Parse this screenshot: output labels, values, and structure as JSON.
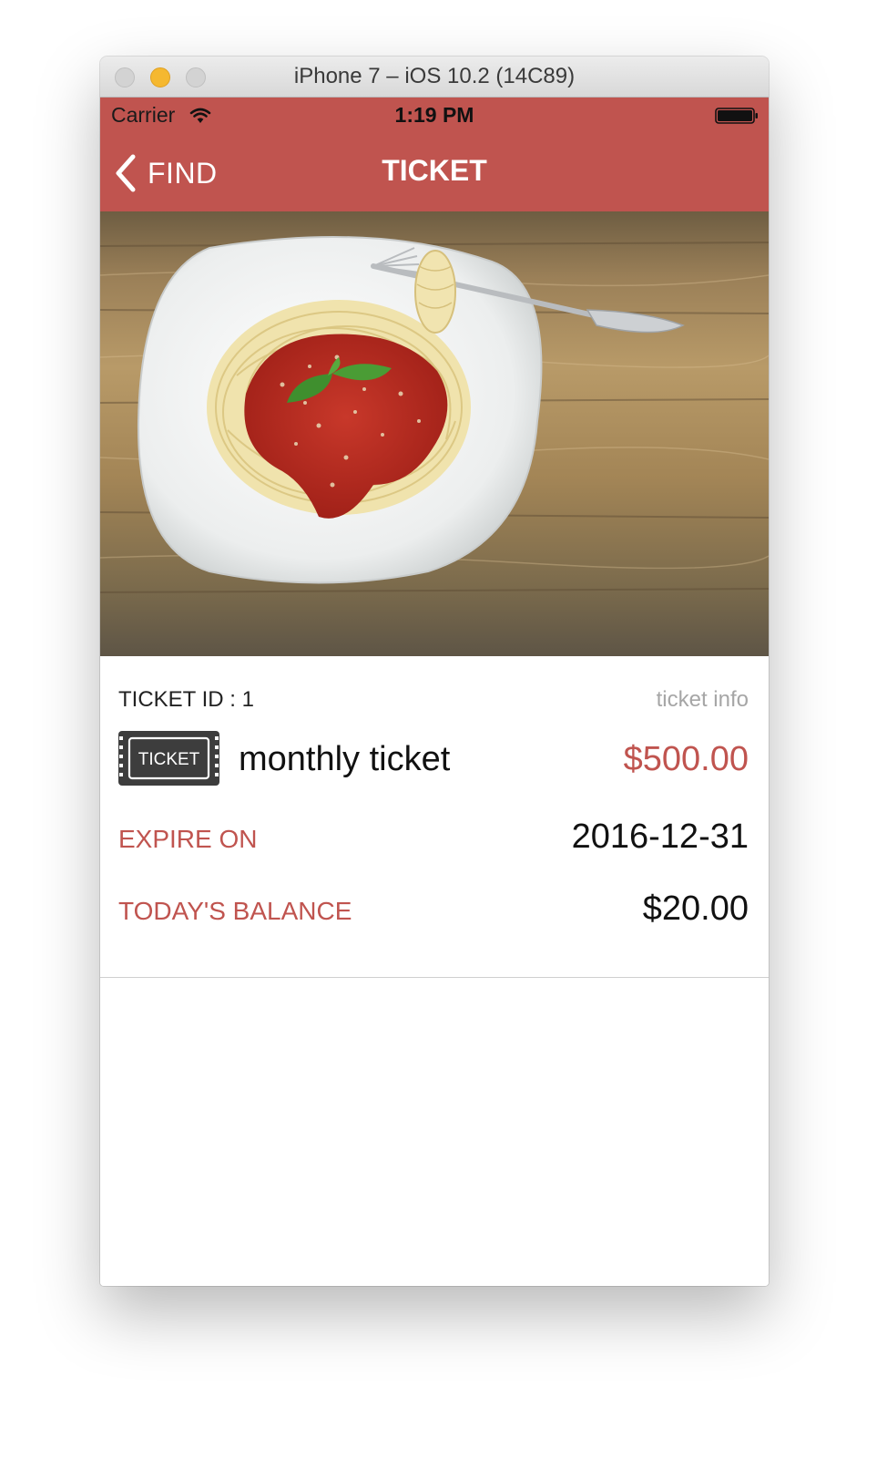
{
  "window": {
    "title": "iPhone 7 – iOS 10.2 (14C89)"
  },
  "status_bar": {
    "carrier": "Carrier",
    "time": "1:19 PM",
    "wifi_icon": "wifi-icon",
    "battery_icon": "battery-icon"
  },
  "nav": {
    "back_label": "FIND",
    "back_icon": "chevron-left-icon",
    "title": "TICKET"
  },
  "photo": {
    "subject": "spaghetti-plate-image"
  },
  "ticket": {
    "id_label": "TICKET ID : 1",
    "info_link": "ticket info",
    "badge_text": "TICKET",
    "name": "monthly ticket",
    "price": "$500.00",
    "expire_label": "EXPIRE ON",
    "expire_value": "2016-12-31",
    "balance_label": "TODAY'S BALANCE",
    "balance_value": "$20.00"
  },
  "colors": {
    "accent": "#c0544f",
    "nav_background": "#c0544f",
    "muted_text": "#a6a6a6"
  }
}
